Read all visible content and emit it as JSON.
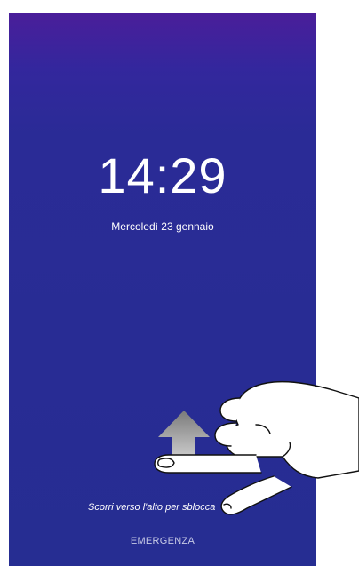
{
  "lockscreen": {
    "time": "14:29",
    "date": "Mercoledì 23 gennaio",
    "swipe_hint": "Scorri verso l'alto per sblocca",
    "emergency_label": "EMERGENZA",
    "arrow_icon": "up-arrow-icon",
    "hand_icon": "pointing-hand-icon",
    "gradient_top": "#4a1e9a",
    "gradient_bottom": "#262d92"
  }
}
